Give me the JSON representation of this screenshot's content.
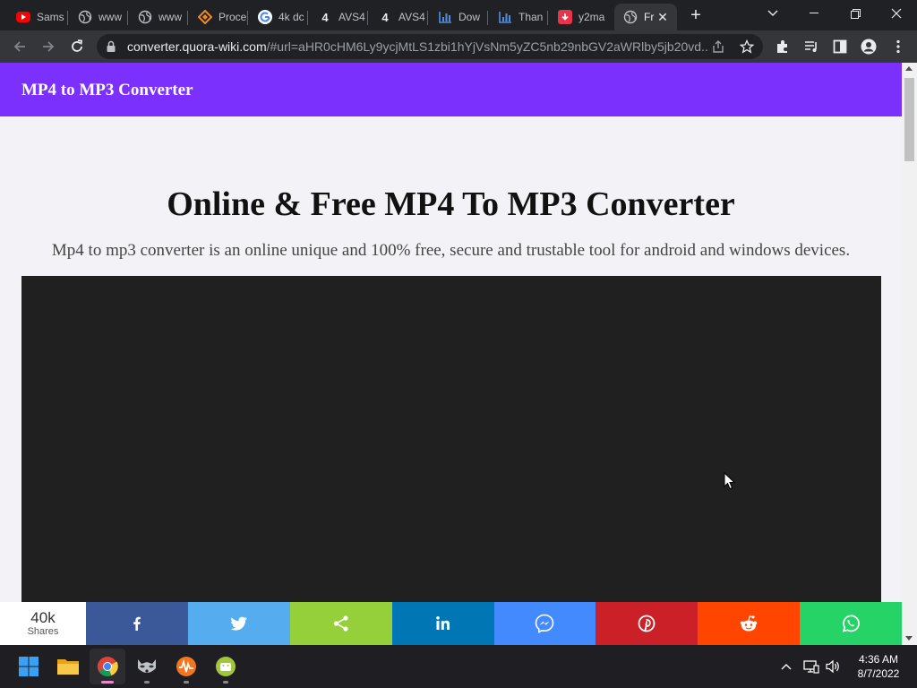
{
  "browser": {
    "tabs": [
      {
        "title": "Sams",
        "favicon": "youtube-icon",
        "color": "#ff0000"
      },
      {
        "title": "www",
        "favicon": "globe-icon",
        "color": "#9aa0a6"
      },
      {
        "title": "www",
        "favicon": "globe-icon",
        "color": "#9aa0a6"
      },
      {
        "title": "Proce",
        "favicon": "diamond-icon",
        "color": "#f28b25"
      },
      {
        "title": "4k dc",
        "favicon": "google-icon",
        "color": "#ffffff"
      },
      {
        "title": "AVS4",
        "favicon": "four-icon",
        "color": "#e8eaed"
      },
      {
        "title": "AVS4",
        "favicon": "four-icon",
        "color": "#e8eaed"
      },
      {
        "title": "Dow",
        "favicon": "bar-chart-icon",
        "color": "#4e8de6"
      },
      {
        "title": "Than",
        "favicon": "bar-chart-icon",
        "color": "#4e8de6"
      },
      {
        "title": "y2ma",
        "favicon": "download-icon",
        "color": "#e8344a"
      },
      {
        "title": "Fr",
        "favicon": "globe-icon",
        "color": "#9aa0a6",
        "active": true
      }
    ],
    "address": {
      "domain": "converter.quora-wiki.com",
      "path": "/#url=aHR0cHM6Ly9ycjMtLS1zbi1hYjVsNm5yZC5nb29nbGV2aWRlby5jb20vd..."
    }
  },
  "site": {
    "logo_text": "MP4 to MP3 Converter",
    "header_color": "#7c30fe",
    "title": "Online & Free MP4 To MP3 Converter",
    "subtitle": "Mp4 to mp3 converter is an online unique and 100% free, secure and trustable tool for android and windows devices."
  },
  "share": {
    "count": "40k",
    "count_label": "Shares",
    "buttons": [
      {
        "network": "facebook",
        "icon": "facebook-icon",
        "color": "#3b5998"
      },
      {
        "network": "twitter",
        "icon": "twitter-icon",
        "color": "#55acee"
      },
      {
        "network": "sharethis",
        "icon": "share-icon",
        "color": "#95d03a"
      },
      {
        "network": "linkedin",
        "icon": "linkedin-icon",
        "color": "#0077b5"
      },
      {
        "network": "messenger",
        "icon": "messenger-icon",
        "color": "#448aff"
      },
      {
        "network": "pinterest",
        "icon": "pinterest-icon",
        "color": "#cb2027"
      },
      {
        "network": "reddit",
        "icon": "reddit-icon",
        "color": "#ff4500"
      },
      {
        "network": "whatsapp",
        "icon": "whatsapp-icon",
        "color": "#25d366"
      }
    ]
  },
  "taskbar": {
    "apps": [
      "windows-start-icon",
      "file-explorer-icon",
      "chrome-icon",
      "raccoon-app-icon",
      "audio-app-icon",
      "android-app-icon"
    ],
    "time": "4:36 AM",
    "date": "8/7/2022"
  }
}
